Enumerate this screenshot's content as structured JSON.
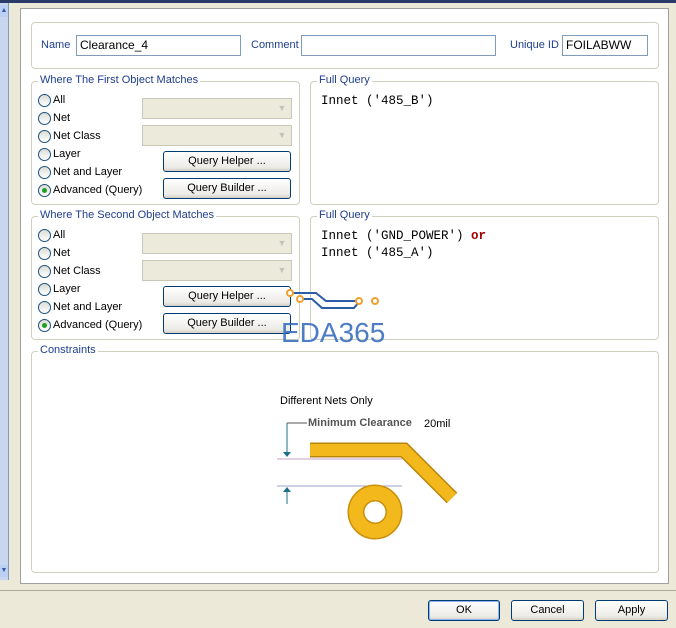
{
  "name_label": "Name",
  "name_value": "Clearance_4",
  "comment_label": "Comment",
  "comment_value": "",
  "uid_label": "Unique ID",
  "uid_value": "FOILABWW",
  "first": {
    "title": "Where The First Object Matches",
    "options": [
      "All",
      "Net",
      "Net Class",
      "Layer",
      "Net and Layer",
      "Advanced (Query)"
    ],
    "selected": "Advanced (Query)",
    "helper": "Query Helper ...",
    "builder": "Query Builder ...",
    "query_title": "Full Query",
    "query_line1": "Innet ('485_B')"
  },
  "second": {
    "title": "Where The Second Object Matches",
    "options": [
      "All",
      "Net",
      "Net Class",
      "Layer",
      "Net and Layer",
      "Advanced (Query)"
    ],
    "selected": "Advanced (Query)",
    "helper": "Query Helper ...",
    "builder": "Query Builder ...",
    "query_title": "Full Query",
    "query_line1": "Innet ('GND_POWER') ",
    "query_op": "or",
    "query_line2": "Innet ('485_A')"
  },
  "constraints": {
    "title": "Constraints",
    "scope": "Different Nets Only",
    "min_label": "Minimum Clearance",
    "min_value": "20mil"
  },
  "watermark": "EDA365",
  "buttons": {
    "ok": "OK",
    "cancel": "Cancel",
    "apply": "Apply"
  },
  "colors": {
    "copper": "#f2b81c",
    "label_blue": "#1e3e8c",
    "query_op": "#a00000"
  }
}
